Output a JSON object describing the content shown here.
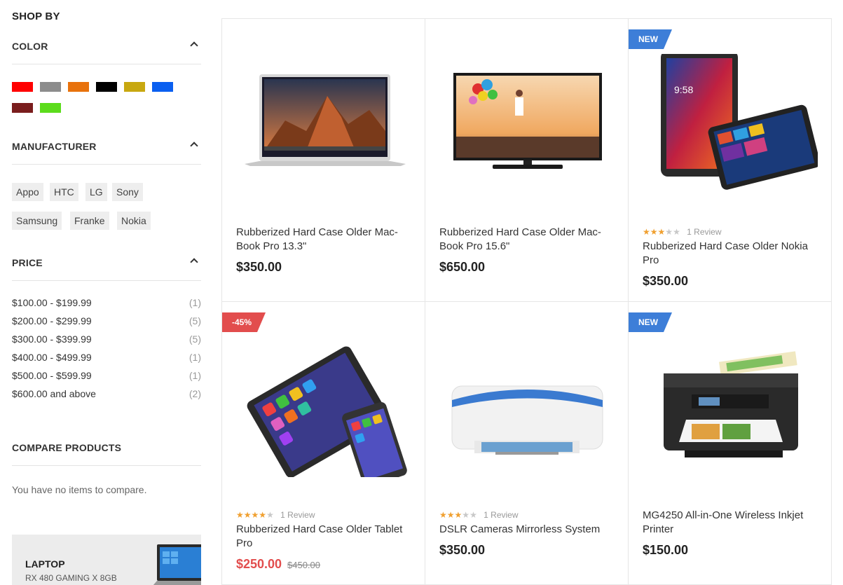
{
  "sidebar": {
    "shop_by": "SHOP BY",
    "color_title": "COLOR",
    "colors": [
      "#ff0000",
      "#8c8c8c",
      "#e8720c",
      "#000000",
      "#c8a810",
      "#0a5ff0",
      "#7a1d1d",
      "#5cdc1c"
    ],
    "manufacturer_title": "MANUFACTURER",
    "manufacturers": [
      "Appo",
      "HTC",
      "LG",
      "Sony",
      "Samsung",
      "Franke",
      "Nokia"
    ],
    "price_title": "PRICE",
    "prices": [
      {
        "label": "$100.00 - $199.99",
        "count": "(1)"
      },
      {
        "label": "$200.00 - $299.99",
        "count": "(5)"
      },
      {
        "label": "$300.00 - $399.99",
        "count": "(5)"
      },
      {
        "label": "$400.00 - $499.99",
        "count": "(1)"
      },
      {
        "label": "$500.00 - $599.99",
        "count": "(1)"
      },
      {
        "label": "$600.00 and above",
        "count": "(2)"
      }
    ],
    "compare_title": "COMPARE PRODUCTS",
    "compare_text": "You have no items to compare.",
    "banner_title": "LAPTOP",
    "banner_sub": "RX 480 GAMING X 8GB"
  },
  "products": [
    {
      "name": "Rubberized Hard Case Older Mac-Book Pro 13.3\"",
      "price": "$350.00",
      "badge": "",
      "rating": 0,
      "reviews": "",
      "old_price": "",
      "image": "laptop-image"
    },
    {
      "name": "Rubberized Hard Case Older Mac-Book Pro 15.6\"",
      "price": "$650.00",
      "badge": "",
      "rating": 0,
      "reviews": "",
      "old_price": "",
      "image": "tv-image"
    },
    {
      "name": "Rubberized Hard Case Older Nokia Pro",
      "price": "$350.00",
      "badge": "NEW",
      "rating": 3,
      "reviews": "1 Review",
      "old_price": "",
      "image": "tablet-image"
    },
    {
      "name": "Rubberized Hard Case Older Tablet Pro",
      "price": "$250.00",
      "badge": "-45%",
      "rating": 4,
      "reviews": "1 Review",
      "old_price": "$450.00",
      "image": "ipad-image"
    },
    {
      "name": "DSLR Cameras Mirrorless System",
      "price": "$350.00",
      "badge": "",
      "rating": 3,
      "reviews": "1 Review",
      "old_price": "",
      "image": "printer-image"
    },
    {
      "name": "MG4250 All-in-One Wireless Inkjet Printer",
      "price": "$150.00",
      "badge": "NEW",
      "rating": 0,
      "reviews": "",
      "old_price": "",
      "image": "inkjet-image"
    }
  ],
  "colors": {
    "star_on": "#f0a030",
    "star_off": "#c8c8c8",
    "badge_new": "#3d7ed8",
    "badge_sale": "#e24d4d",
    "sale_price": "#e24d4d"
  }
}
